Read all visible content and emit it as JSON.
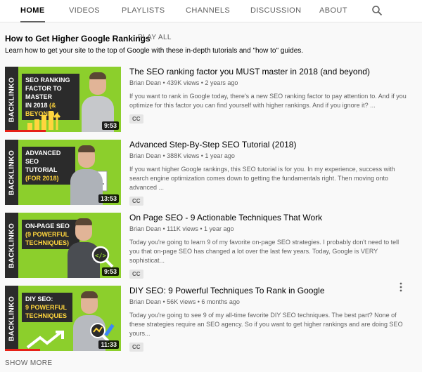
{
  "tabs": [
    {
      "label": "HOME",
      "active": true
    },
    {
      "label": "VIDEOS",
      "active": false
    },
    {
      "label": "PLAYLISTS",
      "active": false
    },
    {
      "label": "CHANNELS",
      "active": false
    },
    {
      "label": "DISCUSSION",
      "active": false
    },
    {
      "label": "ABOUT",
      "active": false
    }
  ],
  "search_icon": "search-icon",
  "section": {
    "title": "How to Get Higher Google Rankings",
    "play_all": "PLAY ALL",
    "description": "Learn how to get your site to the top of Google with these in-depth tutorials and \"how to\" guides."
  },
  "videos": [
    {
      "title": "The SEO ranking factor you MUST master in 2018 (and beyond)",
      "channel": "Brian Dean",
      "views": "439K views",
      "age": "2 years ago",
      "meta": "Brian Dean • 439K views • 2 years ago",
      "description": "If you want to rank in Google today, there's a new SEO ranking factor to pay attention to. And if you optimize for this factor you can find yourself with higher rankings. And if you ignore it? ...",
      "cc": "CC",
      "duration": "9:53",
      "brand": "BACKLINKO",
      "thumb_lines": [
        "SEO RANKING",
        "FACTOR TO MASTER",
        "IN 2018"
      ],
      "thumb_highlight": "(& BEYOND)",
      "watched_fraction": 0.35
    },
    {
      "title": "Advanced Step-By-Step SEO Tutorial (2018)",
      "channel": "Brian Dean",
      "views": "388K views",
      "age": "1 year ago",
      "meta": "Brian Dean • 388K views • 1 year ago",
      "description": "If you want higher Google rankings, this SEO tutorial is for you. In my experience, success with search engine optimization comes down to getting the fundamentals right. Then moving onto advanced ...",
      "cc": "CC",
      "duration": "13:53",
      "brand": "BACKLINKO",
      "thumb_lines": [
        "ADVANCED",
        "SEO TUTORIAL"
      ],
      "thumb_highlight": "(FOR 2018)",
      "watched_fraction": 0.0
    },
    {
      "title": "On Page SEO - 9 Actionable Techniques That Work",
      "channel": "Brian Dean",
      "views": "111K views",
      "age": "1 year ago",
      "meta": "Brian Dean • 111K views • 1 year ago",
      "description": "Today you're going to learn 9 of my favorite on-page SEO strategies. I probably don't need to tell you that on-page SEO has changed a lot over the last few years. Today, Google is VERY sophisticat...",
      "cc": "CC",
      "duration": "9:53",
      "brand": "BACKLINKO",
      "thumb_lines": [
        "ON-PAGE SEO"
      ],
      "thumb_highlight": "(9 POWERFUL TECHNIQUES)",
      "watched_fraction": 0.0
    },
    {
      "title": "DIY SEO: 9 Powerful Techniques To Rank in Google",
      "channel": "Brian Dean",
      "views": "56K views",
      "age": "6 months ago",
      "meta": "Brian Dean • 56K views • 6 months ago",
      "description": "Today you're going to see 9 of my all-time favorite DIY SEO techniques. The best part? None of these strategies require an SEO agency. So if you want to get higher rankings and are doing SEO yours...",
      "cc": "CC",
      "duration": "11:33",
      "brand": "BACKLINKO",
      "thumb_lines": [
        "DIY SEO:"
      ],
      "thumb_highlight": "9 POWERFUL TECHNIQUES",
      "watched_fraction": 0.3
    }
  ],
  "more_icon": "more-vert-icon",
  "show_more": "SHOW MORE",
  "colors": {
    "accent_green": "#8ccf2c",
    "banner_dark": "#2b2b2b",
    "highlight_yellow": "#ffd53d",
    "progress_red": "#e62117"
  }
}
